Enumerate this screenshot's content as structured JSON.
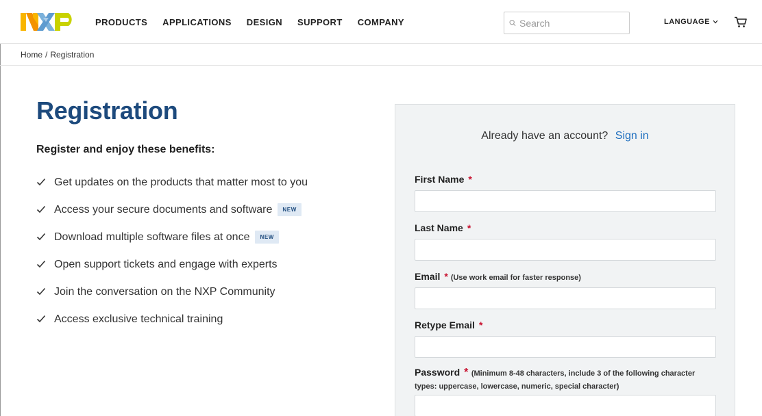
{
  "header": {
    "logo_text": "NXP",
    "nav": [
      "PRODUCTS",
      "APPLICATIONS",
      "DESIGN",
      "SUPPORT",
      "COMPANY"
    ],
    "search_placeholder": "Search",
    "language_label": "LANGUAGE",
    "icons": [
      "search-icon",
      "chevron-down-icon",
      "cart-icon"
    ]
  },
  "breadcrumb": {
    "home": "Home",
    "separator": "/",
    "current": "Registration"
  },
  "main": {
    "title": "Registration",
    "benefits_heading": "Register and enjoy these benefits:",
    "benefits": [
      {
        "text": "Get updates on the products that matter most to you",
        "badge": ""
      },
      {
        "text": "Access your secure documents and software",
        "badge": "NEW"
      },
      {
        "text": "Download multiple software files at once",
        "badge": "NEW"
      },
      {
        "text": "Open support tickets and engage with experts",
        "badge": ""
      },
      {
        "text": "Join the conversation on the NXP Community",
        "badge": ""
      },
      {
        "text": "Access exclusive technical training",
        "badge": ""
      }
    ]
  },
  "form": {
    "already_text": "Already have an account?",
    "signin_label": "Sign in",
    "required_mark": "*",
    "fields": {
      "first_name": {
        "label": "First Name",
        "value": "",
        "hint": ""
      },
      "last_name": {
        "label": "Last Name",
        "value": "",
        "hint": ""
      },
      "email": {
        "label": "Email",
        "value": "",
        "hint": "(Use work email for faster response)"
      },
      "retype_email": {
        "label": "Retype Email",
        "value": "",
        "hint": ""
      },
      "password": {
        "label": "Password",
        "value": "",
        "hint": "(Minimum 8-48 characters, include 3 of the following character types: uppercase, lowercase, numeric, special character)"
      }
    }
  },
  "colors": {
    "title_blue": "#1d4a7d",
    "link_blue": "#1f6fbf",
    "required_red": "#c8102e",
    "panel_bg": "#f1f3f4",
    "logo_orange": "#f9b500",
    "logo_blue": "#7bb1db",
    "logo_green": "#c9d200"
  }
}
